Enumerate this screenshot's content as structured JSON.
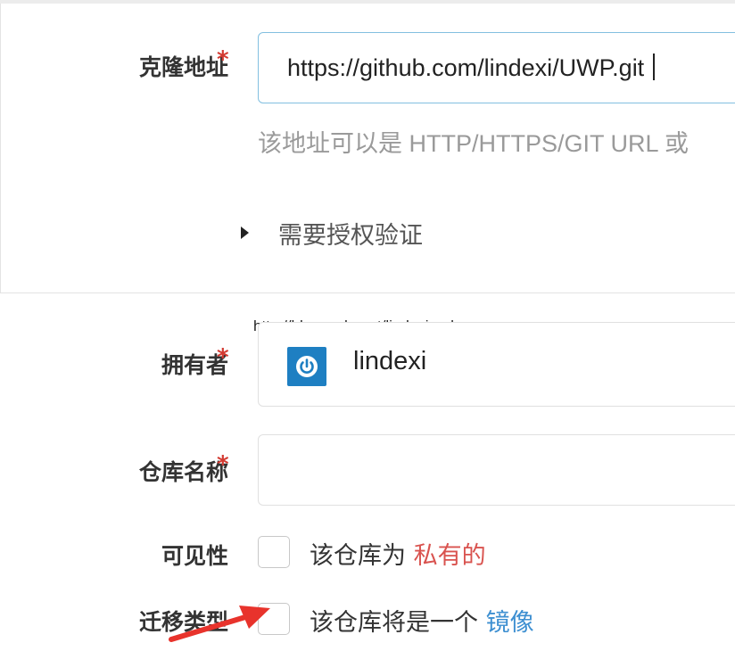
{
  "clone_url": {
    "label": "克隆地址",
    "required_mark": "*",
    "value": "https://github.com/lindexi/UWP.git",
    "hint": "该地址可以是 HTTP/HTTPS/GIT URL 或"
  },
  "auth": {
    "toggle_label": "需要授权验证"
  },
  "watermark": "http://blog.csdn.net/lindexi_gd",
  "owner": {
    "label": "拥有者",
    "required_mark": "*",
    "name": "lindexi",
    "avatar_icon": "power-icon",
    "avatar_color": "#1e7fc2"
  },
  "repo_name": {
    "label": "仓库名称",
    "required_mark": "*",
    "value": ""
  },
  "visibility": {
    "label": "可见性",
    "text_prefix": "该仓库为",
    "text_highlight": "私有的",
    "highlight_color": "#d9534f"
  },
  "migration_type": {
    "label": "迁移类型",
    "text_prefix": "该仓库将是一个",
    "text_highlight": "镜像",
    "highlight_color": "#3d8fd1"
  },
  "annotation": {
    "arrow_color": "#e8332c"
  }
}
